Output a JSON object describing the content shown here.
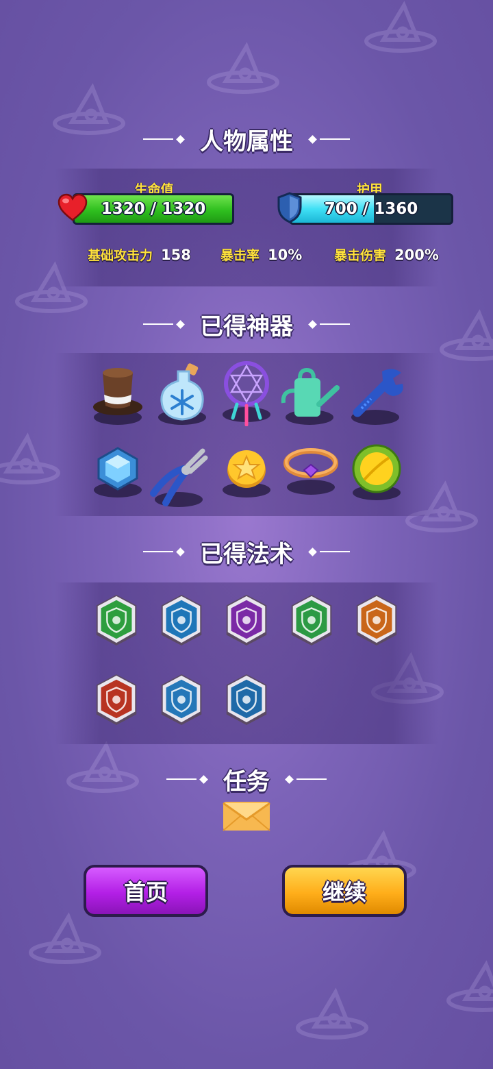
{
  "sections": {
    "attributes": "人物属性",
    "artifacts": "已得神器",
    "spells": "已得法术",
    "tasks": "任务"
  },
  "hp": {
    "label": "生命值",
    "text": "1320 / 1320",
    "fill": 1.0,
    "color": "#2fbf1f"
  },
  "armor": {
    "label": "护甲",
    "text": "700 / 1360",
    "fill": 0.515,
    "color": "#3fe0f5"
  },
  "stats": [
    {
      "key": "基础攻击力",
      "value": "158"
    },
    {
      "key": "暴击率",
      "value": "10%"
    },
    {
      "key": "暴击伤害",
      "value": "200%"
    }
  ],
  "artifacts": [
    {
      "icon": "top-hat-icon"
    },
    {
      "icon": "snowflake-potion-icon"
    },
    {
      "icon": "dreamcatcher-icon"
    },
    {
      "icon": "watering-can-icon"
    },
    {
      "icon": "wrench-icon"
    },
    {
      "icon": "blue-gem-icon"
    },
    {
      "icon": "pliers-icon"
    },
    {
      "icon": "gold-star-coin-icon"
    },
    {
      "icon": "gem-ring-icon"
    },
    {
      "icon": "durian-icon"
    }
  ],
  "spells": [
    {
      "icon": "poison-skull-spell-icon",
      "color": "#2e9e3e"
    },
    {
      "icon": "frost-spell-icon",
      "color": "#1f76b8"
    },
    {
      "icon": "arcane-shield-spell-icon",
      "color": "#7b2aa6"
    },
    {
      "icon": "speed-shield-spell-icon",
      "color": "#2c9a44"
    },
    {
      "icon": "lightning-shield-spell-icon",
      "color": "#c9661a"
    },
    {
      "icon": "fire-ring-spell-icon",
      "color": "#b83422"
    },
    {
      "icon": "heal-shield-spell-icon",
      "color": "#2577b8"
    },
    {
      "icon": "boot-shield-spell-icon",
      "color": "#1f6aa8"
    }
  ],
  "task_icon": "envelope-icon",
  "buttons": {
    "home": "首页",
    "continue": "继续"
  },
  "colors": {
    "home_button": "#b31fe6",
    "continue_button": "#ffae1a"
  }
}
